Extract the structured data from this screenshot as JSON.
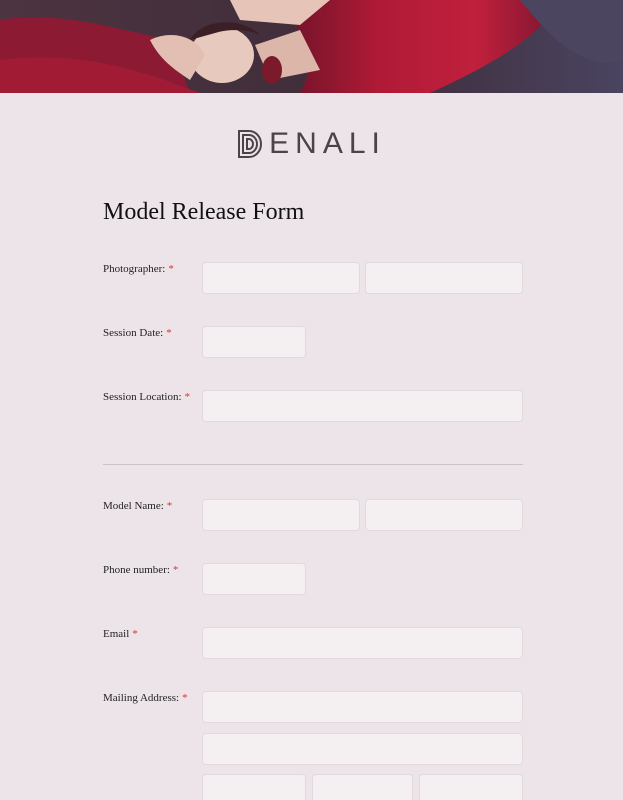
{
  "brand": {
    "name": "ENALI"
  },
  "form": {
    "title": "Model Release Form",
    "required_marker": "*",
    "fields": {
      "photographer": "Photographer:",
      "session_date": "Session Date:",
      "session_location": "Session Location:",
      "model_name": "Model Name:",
      "phone_number": "Phone number:",
      "email": "Email",
      "mailing_address": "Mailing Address:"
    }
  },
  "colors": {
    "background": "#ede4e9",
    "field_bg": "#f4f0f2",
    "required": "#e0302c",
    "hero_red": "#a0182f"
  }
}
